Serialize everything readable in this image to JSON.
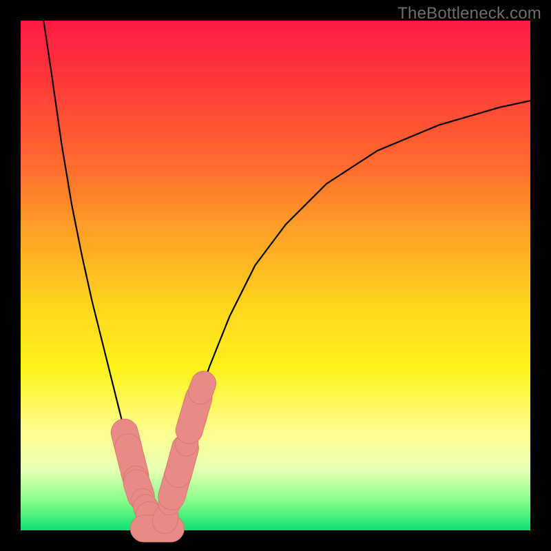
{
  "watermark": "TheBottleneck.com",
  "colors": {
    "frame": "#000000",
    "curve": "#000000",
    "bead_fill": "#e88b87",
    "bead_stroke": "#d9726d"
  },
  "chart_data": {
    "type": "line",
    "title": "",
    "xlabel": "",
    "ylabel": "",
    "x_range": [
      0,
      100
    ],
    "y_range": [
      0,
      100
    ],
    "grid": false,
    "legend": false,
    "background_gradient": [
      "#ff1a44",
      "#ffa326",
      "#fff21a",
      "#10e070"
    ],
    "series": [
      {
        "name": "left-curve",
        "x": [
          4.5,
          6,
          8,
          10,
          12,
          14,
          16,
          18,
          20,
          21.5,
          22.5,
          23.5,
          24.5,
          25.5,
          26.4
        ],
        "y": [
          100,
          90,
          76,
          64,
          54,
          45,
          37,
          29,
          21,
          15,
          11,
          8,
          5,
          2.5,
          0.5
        ]
      },
      {
        "name": "right-curve",
        "x": [
          27.6,
          28.6,
          30,
          32,
          34,
          37,
          41,
          46,
          52,
          60,
          70,
          82,
          94,
          100
        ],
        "y": [
          0.5,
          3,
          8,
          15,
          23,
          32,
          42,
          52,
          60,
          68,
          74.5,
          79.5,
          83,
          84.3
        ]
      },
      {
        "name": "valley-floor",
        "x": [
          26.4,
          27.0,
          27.6
        ],
        "y": [
          0.5,
          0.3,
          0.5
        ]
      }
    ],
    "beads": [
      {
        "along": "left-curve",
        "x": 20.8,
        "y": 17.5,
        "len": 4.0,
        "w": 2.4
      },
      {
        "along": "left-curve",
        "x": 21.8,
        "y": 13.5,
        "len": 5.0,
        "w": 2.4
      },
      {
        "along": "left-curve",
        "x": 22.6,
        "y": 10.2,
        "len": 2.2,
        "w": 2.2
      },
      {
        "along": "left-curve",
        "x": 23.2,
        "y": 8.0,
        "len": 3.6,
        "w": 2.4
      },
      {
        "along": "left-curve",
        "x": 23.9,
        "y": 6.0,
        "len": 2.0,
        "w": 2.0
      },
      {
        "along": "left-curve",
        "x": 24.6,
        "y": 4.4,
        "len": 2.4,
        "w": 2.2
      },
      {
        "along": "left-curve",
        "x": 25.4,
        "y": 2.6,
        "len": 2.8,
        "w": 2.4
      },
      {
        "along": "valley-floor",
        "x": 26.8,
        "y": 0.35,
        "len": 4.8,
        "w": 2.4
      },
      {
        "along": "right-curve",
        "x": 28.4,
        "y": 2.2,
        "len": 2.6,
        "w": 2.2
      },
      {
        "along": "right-curve",
        "x": 29.2,
        "y": 5.2,
        "len": 2.0,
        "w": 2.0
      },
      {
        "along": "right-curve",
        "x": 30.3,
        "y": 9.0,
        "len": 4.6,
        "w": 2.4
      },
      {
        "along": "right-curve",
        "x": 31.6,
        "y": 13.6,
        "len": 4.8,
        "w": 2.4
      },
      {
        "along": "right-curve",
        "x": 32.6,
        "y": 17.0,
        "len": 2.2,
        "w": 2.0
      },
      {
        "along": "right-curve",
        "x": 34.0,
        "y": 22.8,
        "len": 5.4,
        "w": 2.4
      },
      {
        "along": "right-curve",
        "x": 35.6,
        "y": 28.0,
        "len": 3.0,
        "w": 2.2
      }
    ]
  }
}
